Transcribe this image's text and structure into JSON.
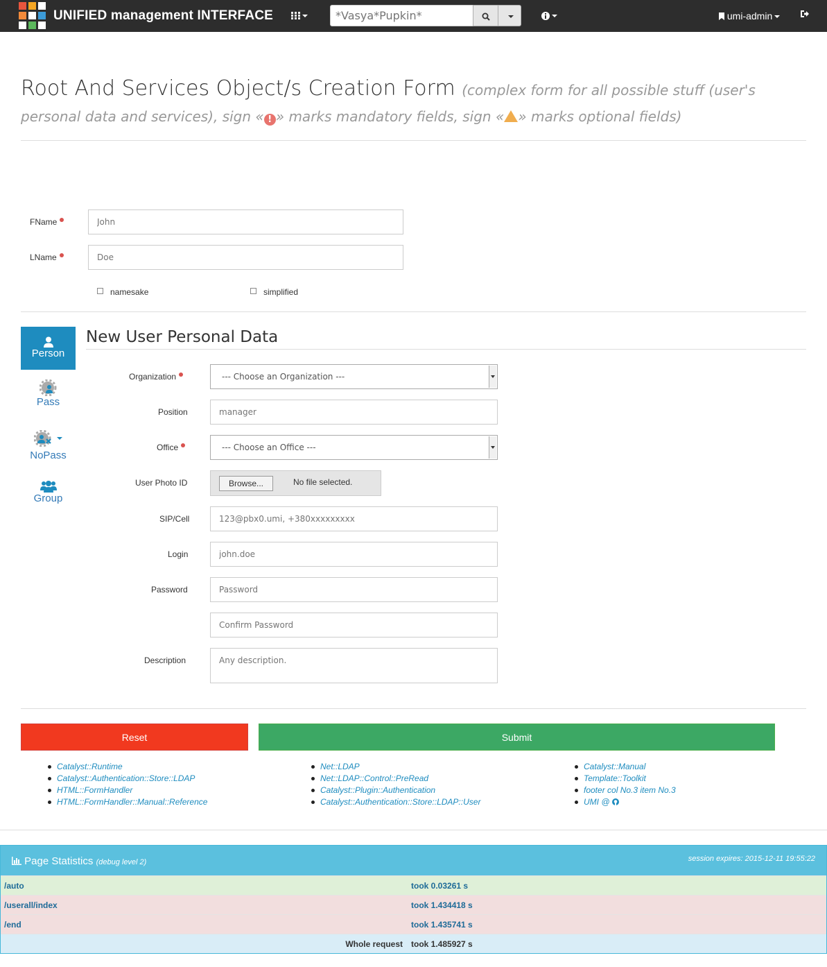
{
  "navbar": {
    "brand": "UNIFIED management INTERFACE",
    "search_placeholder": "*Vasya*Pupkin*",
    "user": "umi-admin"
  },
  "page": {
    "title": "Root And Services Object/s Creation Form",
    "subtitle_a": "(complex form for all possible stuff (user's personal data and services), sign «",
    "subtitle_b": "» marks mandatory fields, sign «",
    "subtitle_c": "» marks optional fields)"
  },
  "root_form": {
    "fname_label": "FName",
    "fname_placeholder": "John",
    "lname_label": "LName",
    "lname_placeholder": "Doe",
    "namesake_label": "namesake",
    "simplified_label": "simplified"
  },
  "sidebar": {
    "items": [
      {
        "label": "Person"
      },
      {
        "label": "Pass"
      },
      {
        "label": "NoPass"
      },
      {
        "label": "Group"
      }
    ]
  },
  "section": {
    "title": "New User Personal Data",
    "organization_label": "Organization",
    "organization_value": "--- Choose an Organization ---",
    "position_label": "Position",
    "position_placeholder": "manager",
    "office_label": "Office",
    "office_value": "--- Choose an Office ---",
    "photo_label": "User Photo ID",
    "browse_label": "Browse...",
    "no_file": "No file selected.",
    "sip_label": "SIP/Cell",
    "sip_placeholder": "123@pbx0.umi, +380xxxxxxxxx",
    "login_label": "Login",
    "login_placeholder": "john.doe",
    "password_label": "Password",
    "password_placeholder": "Password",
    "confirm_placeholder": "Confirm Password",
    "description_label": "Description",
    "description_placeholder": "Any description."
  },
  "actions": {
    "reset": "Reset",
    "submit": "Submit"
  },
  "footer_links": {
    "col1": [
      "Catalyst::Runtime",
      "Catalyst::Authentication::Store::LDAP",
      "HTML::FormHandler",
      "HTML::FormHandler::Manual::Reference"
    ],
    "col2": [
      "Net::LDAP",
      "Net::LDAP::Control::PreRead",
      "Catalyst::Plugin::Authentication",
      "Catalyst::Authentication::Store::LDAP::User"
    ],
    "col3": [
      "Catalyst::Manual",
      "Template::Toolkit",
      "footer col No.3 item No.3",
      "UMI @"
    ]
  },
  "stats": {
    "title": "Page Statistics",
    "debug": "(debug level 2)",
    "session": "session expires: 2015-12-11 19:55:22",
    "rows": [
      {
        "path": "/auto",
        "took": "took 0.03261 s",
        "color": "#dff0d8"
      },
      {
        "path": "/userall/index",
        "took": "took 1.434418 s",
        "color": "#f2dede"
      },
      {
        "path": "/end",
        "took": "took 1.435741 s",
        "color": "#f2dede"
      },
      {
        "path": "Whole request",
        "took": "took 1.485927 s",
        "color": "#d9edf7"
      }
    ]
  },
  "colors": {
    "accent": "#1e8cbf",
    "reset": "#f1391f",
    "submit": "#3ca864",
    "stats_header": "#5bc0de"
  }
}
